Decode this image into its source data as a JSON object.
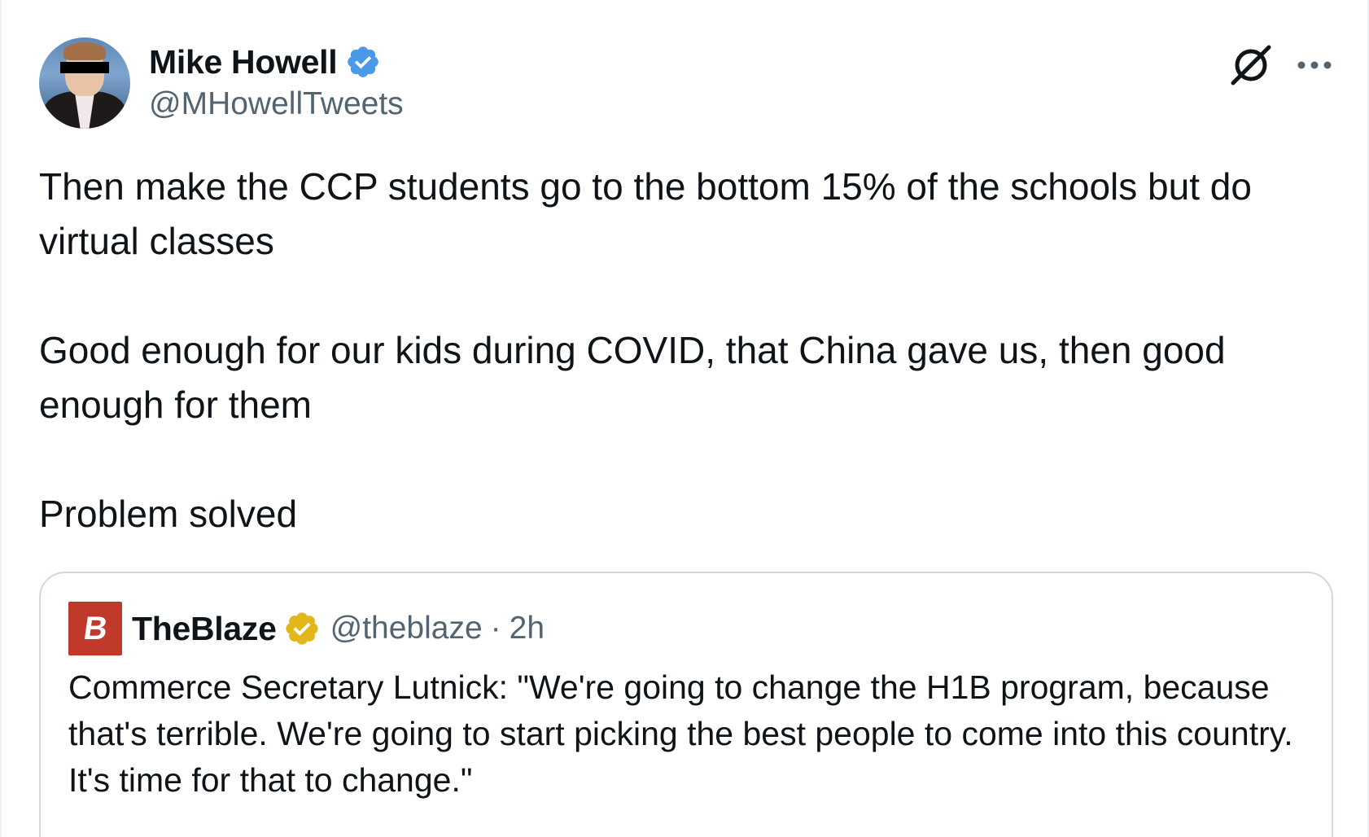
{
  "post": {
    "author": {
      "display_name": "Mike Howell",
      "handle": "@MHowellTweets",
      "verified": true,
      "verified_color": "#4a99e9"
    },
    "paragraphs": [
      "Then make the CCP students go to the bottom 15% of the schools but do virtual classes",
      "Good enough for our kids during COVID, that China gave us, then good enough for them",
      "Problem solved"
    ],
    "icons": {
      "grok": "grok-icon",
      "more": "more-options-icon"
    }
  },
  "quoted_post": {
    "author": {
      "display_name": "TheBlaze",
      "handle": "@theblaze",
      "verified": true,
      "verified_color": "#e2b719",
      "logo_color": "#c0392b",
      "logo_text": "B"
    },
    "separator": "·",
    "time": "2h",
    "text": "Commerce Secretary Lutnick: \"We're going to change the H1B program, because that's terrible. We're going to start picking the best people to come into this country. It's time for that to change.\""
  },
  "colors": {
    "text_primary": "#0f1419",
    "text_secondary": "#536471",
    "border": "#cfd9de"
  }
}
